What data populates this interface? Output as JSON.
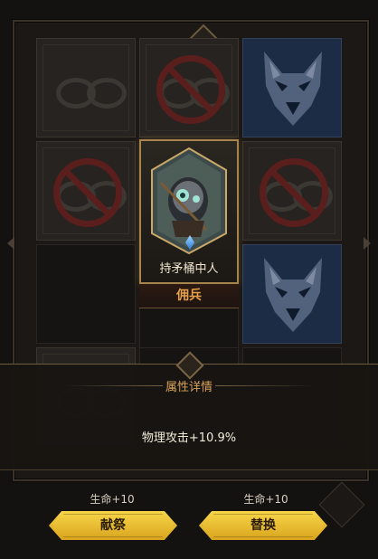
{
  "grid": {
    "cells": [
      {
        "type": "empty"
      },
      {
        "type": "forbidden"
      },
      {
        "type": "wolf"
      },
      {
        "type": "forbidden"
      },
      {
        "type": "hero"
      },
      {
        "type": "forbidden"
      },
      {
        "type": "dark"
      },
      {
        "type": "dark"
      },
      {
        "type": "wolf"
      },
      {
        "type": "empty"
      },
      {
        "type": "dark"
      },
      {
        "type": "dark"
      }
    ]
  },
  "hero": {
    "name": "持矛桶中人",
    "role": "佣兵",
    "gem_color": "#3a8de0",
    "frame_color": "#a8844d"
  },
  "detail": {
    "title": "属性详情",
    "stat": "物理攻击+10.9%"
  },
  "actions": [
    {
      "bonus": "生命+10",
      "label": "献祭"
    },
    {
      "bonus": "生命+10",
      "label": "替换"
    }
  ],
  "colors": {
    "accent_gold": "#f0c93a",
    "role_orange": "#e7a04a",
    "forbidden_red": "#5a1e1c",
    "wolf_blue": "#1d2c45"
  }
}
